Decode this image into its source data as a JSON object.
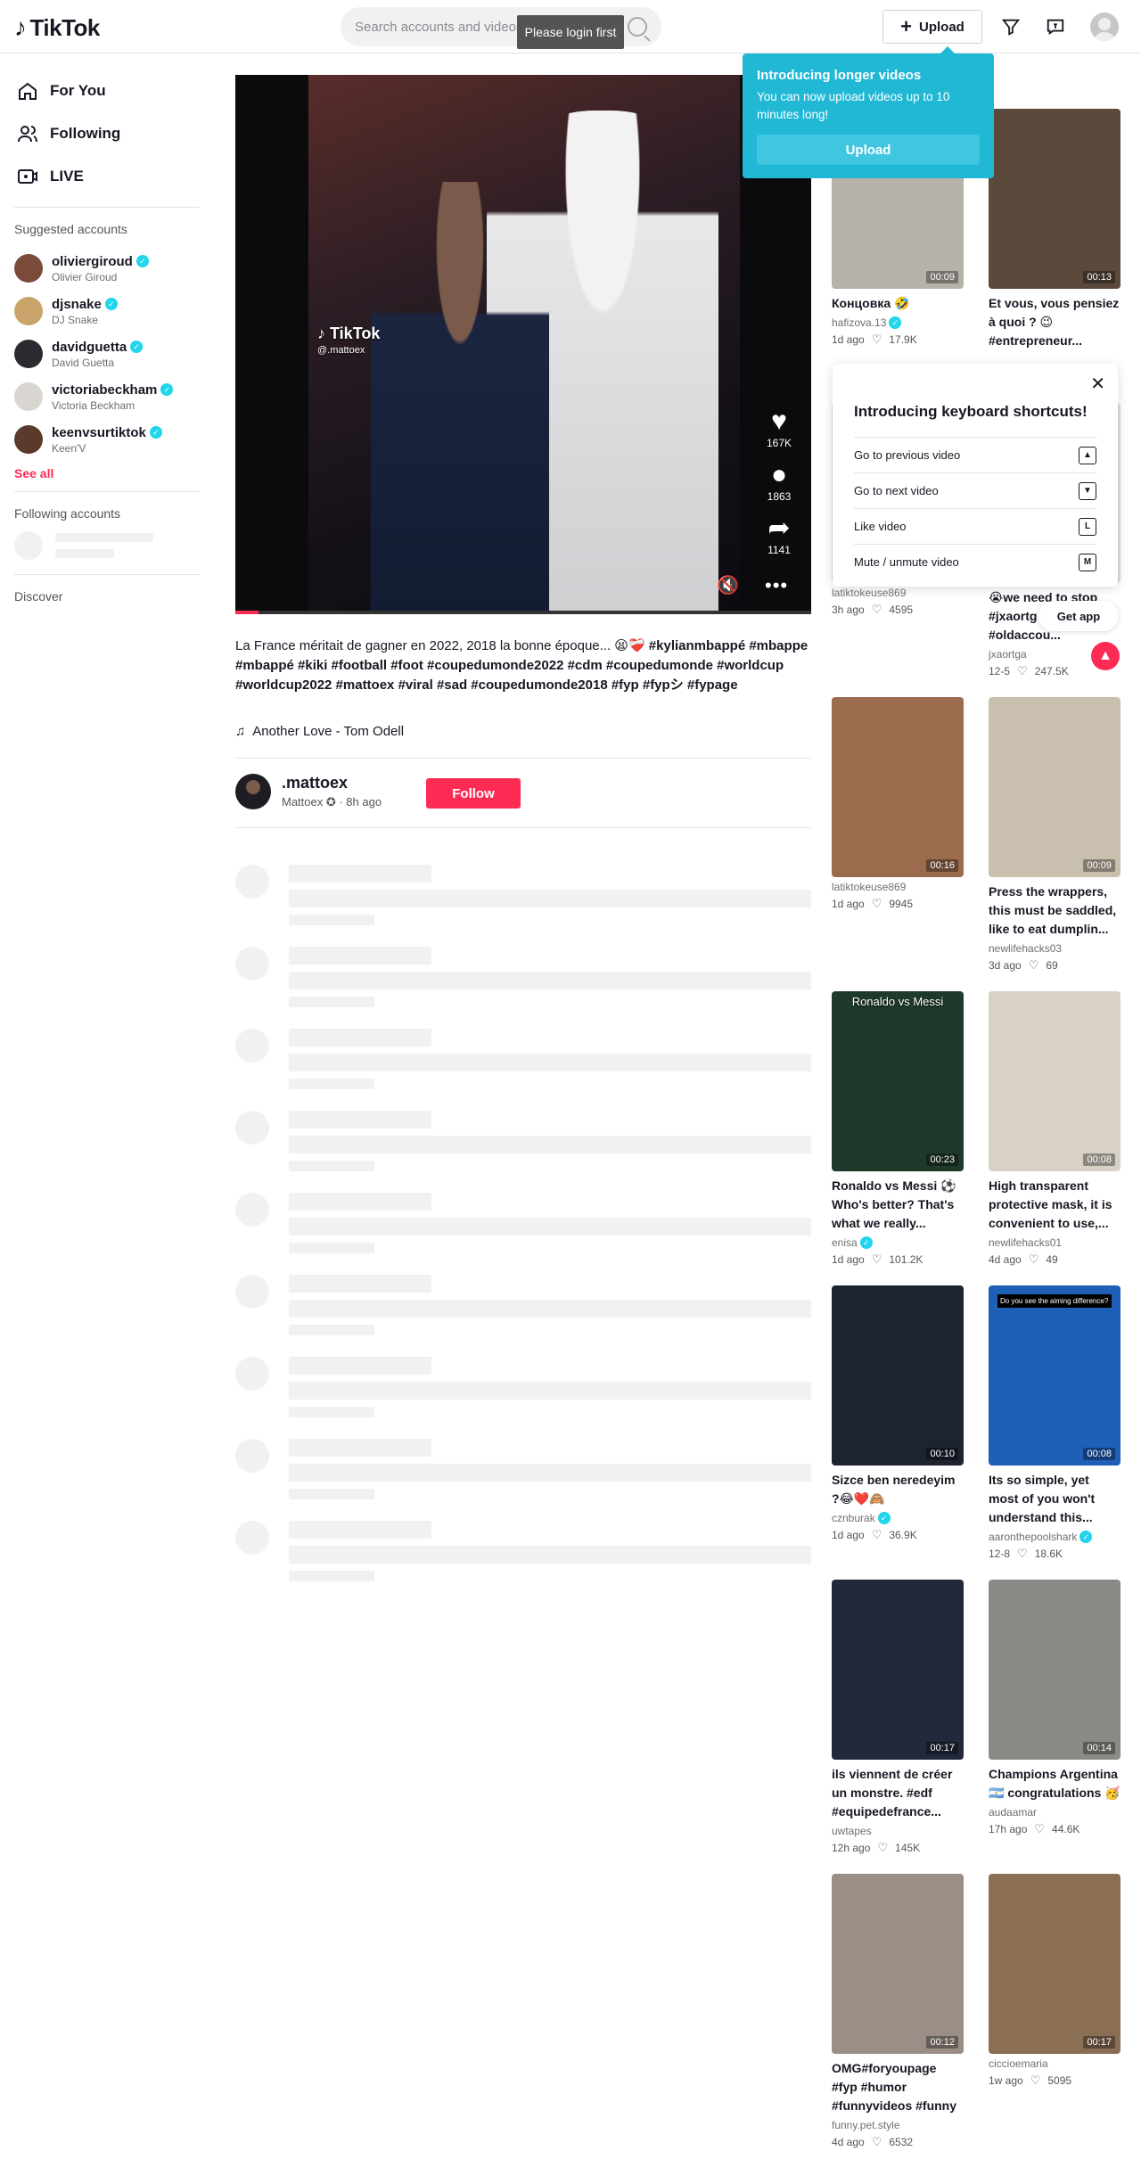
{
  "header": {
    "logo_text": "TikTok",
    "search_placeholder": "Search accounts and videos",
    "login_tooltip": "Please login first",
    "upload_label": "Upload"
  },
  "upload_popover": {
    "title": "Introducing longer videos",
    "body": "You can now upload videos up to 10 minutes long!",
    "button": "Upload"
  },
  "sidebar": {
    "nav": [
      {
        "label": "For You",
        "icon": "home-icon"
      },
      {
        "label": "Following",
        "icon": "users-icon"
      },
      {
        "label": "LIVE",
        "icon": "live-icon"
      }
    ],
    "suggested_title": "Suggested accounts",
    "suggested": [
      {
        "handle": "oliviergiroud",
        "name": "Olivier Giroud",
        "color": "#7a4a3a"
      },
      {
        "handle": "djsnake",
        "name": "DJ Snake",
        "color": "#c9a46a"
      },
      {
        "handle": "davidguetta",
        "name": "David Guetta",
        "color": "#2a2a30"
      },
      {
        "handle": "victoriabeckham",
        "name": "Victoria Beckham",
        "color": "#d9d6d2"
      },
      {
        "handle": "keenvsurtiktok",
        "name": "Keen'V",
        "color": "#5a3a2a"
      }
    ],
    "see_all": "See all",
    "following_title": "Following accounts",
    "discover": "Discover"
  },
  "video": {
    "watermark": "TikTok",
    "watermark_handle": "@.mattoex",
    "likes": "167K",
    "comments": "1863",
    "shares": "1141",
    "progress": 0.04,
    "caption_text": "La France méritait de gagner en 2022, 2018 la bonne époque... 😫❤️‍🩹 ",
    "caption_tags": "#kylianmbappé #mbappe #mbappé #kiki #football #foot #coupedumonde2022 #cdm #coupedumonde #worldcup #worldcup2022 #mattoex #viral #sad #coupedumonde2018 #fyp #fypシ #fypage",
    "music": "Another Love - Tom Odell",
    "author_handle": ".mattoex",
    "author_meta": "Mattoex ✪ · 8h ago",
    "follow_label": "Follow"
  },
  "shortcuts": {
    "title": "Introducing keyboard shortcuts!",
    "rows": [
      {
        "label": "Go to previous video",
        "key": "▲"
      },
      {
        "label": "Go to next video",
        "key": "▼"
      },
      {
        "label": "Like video",
        "key": "L"
      },
      {
        "label": "Mute / unmute video",
        "key": "M"
      }
    ]
  },
  "get_app": "Get app",
  "recommended": [
    {
      "title": "Концовка 🤣",
      "author": "hafizova.13",
      "verified": true,
      "time": "1d ago",
      "likes": "17.9K",
      "duration": "00:09",
      "bg": "#b7b2a9"
    },
    {
      "title": "Et vous, vous pensiez à quoi ? 😉 #entrepreneur...",
      "author": "",
      "verified": false,
      "time": "",
      "likes": "",
      "duration": "00:13",
      "bg": "#5b4a3c"
    },
    {
      "title": "",
      "author": "latiktokeuse869",
      "verified": false,
      "time": "3h ago",
      "likes": "4595",
      "duration": "",
      "bg": "#ddd"
    },
    {
      "title": "😭we need to stop #jxaortg #ortega #oldaccou...",
      "author": "jxaortga",
      "verified": false,
      "time": "12-5",
      "likes": "247.5K",
      "duration": "",
      "bg": "#ddd"
    },
    {
      "title": "",
      "author": "latiktokeuse869",
      "verified": false,
      "time": "1d ago",
      "likes": "9945",
      "duration": "00:16",
      "bg": "#9a6b4c"
    },
    {
      "title": "Press the wrappers, this must be saddled, like to eat dumplin...",
      "author": "newlifehacks03",
      "verified": false,
      "time": "3d ago",
      "likes": "69",
      "duration": "00:09",
      "bg": "#c9bfae"
    },
    {
      "title": "Ronaldo vs Messi ⚽ Who's better? That's what we really...",
      "author": "enisa",
      "verified": true,
      "time": "1d ago",
      "likes": "101.2K",
      "duration": "00:23",
      "bg": "#1f3a2a"
    },
    {
      "title": "High transparent protective mask, it is convenient to use,...",
      "author": "newlifehacks01",
      "verified": false,
      "time": "4d ago",
      "likes": "49",
      "duration": "00:08",
      "bg": "#d8d2c6"
    },
    {
      "title": "Sizce ben neredeyim ?😂❤️🙈",
      "author": "cznburak",
      "verified": true,
      "time": "1d ago",
      "likes": "36.9K",
      "duration": "00:10",
      "bg": "#1d2430"
    },
    {
      "title": "Its so simple, yet most of you won't understand this...",
      "author": "aaronthepoolshark",
      "verified": true,
      "time": "12-8",
      "likes": "18.6K",
      "duration": "00:08",
      "bg": "#1e5fb8"
    },
    {
      "title": "ils viennent de créer un monstre. #edf #equipedefrance...",
      "author": "uwtapes",
      "verified": false,
      "time": "12h ago",
      "likes": "145K",
      "duration": "00:17",
      "bg": "#23283a"
    },
    {
      "title": "Champions Argentina 🇦🇷 congratulations 🥳",
      "author": "audaamar",
      "verified": false,
      "time": "17h ago",
      "likes": "44.6K",
      "duration": "00:14",
      "bg": "#8b8a86"
    },
    {
      "title": "OMG#foryoupage #fyp #humor #funnyvideos #funny",
      "author": "funny.pet.style",
      "verified": false,
      "time": "4d ago",
      "likes": "6532",
      "duration": "00:12",
      "bg": "#9b8e86"
    },
    {
      "title": "",
      "author": "ciccioemaria",
      "verified": false,
      "time": "1w ago",
      "likes": "5095",
      "duration": "00:17",
      "bg": "#8a6f55"
    }
  ],
  "thumb_overlays": {
    "ronaldo_messi": "Ronaldo vs Messi",
    "aiming": "Do you see the aiming difference?"
  }
}
